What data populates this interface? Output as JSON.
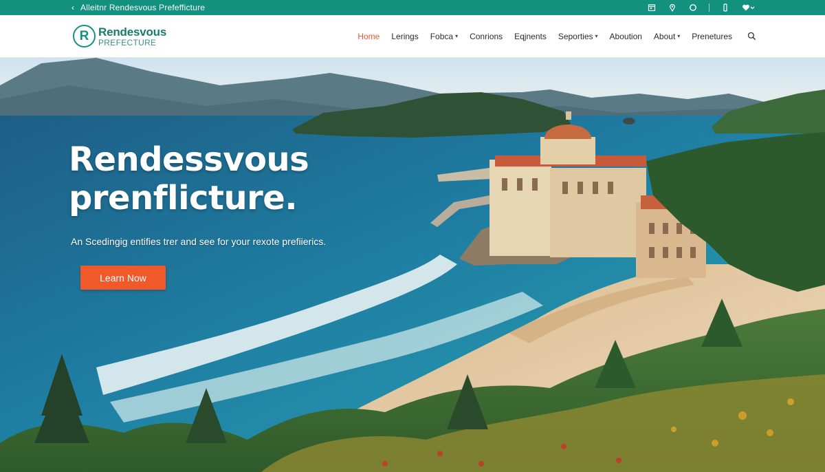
{
  "topbar": {
    "back_glyph": "‹",
    "title": "Alleitnr Rendesvous Prefefficture",
    "icons": [
      "calendar-icon",
      "location-pin-icon",
      "circle-icon",
      "phone-icon",
      "heart-dropdown-icon"
    ]
  },
  "header": {
    "logo_mark": "R",
    "logo_name": "Rendesvous",
    "logo_sub": "PREFECTURE",
    "nav": [
      {
        "label": "Home",
        "active": true,
        "dropdown": false
      },
      {
        "label": "Lerings",
        "active": false,
        "dropdown": false
      },
      {
        "label": "Fobca",
        "active": false,
        "dropdown": true
      },
      {
        "label": "Conrions",
        "active": false,
        "dropdown": false
      },
      {
        "label": "Eqjnents",
        "active": false,
        "dropdown": false
      },
      {
        "label": "Seporties",
        "active": false,
        "dropdown": true
      },
      {
        "label": "Aboution",
        "active": false,
        "dropdown": false
      },
      {
        "label": "About",
        "active": false,
        "dropdown": true
      },
      {
        "label": "Prenetures",
        "active": false,
        "dropdown": false
      }
    ],
    "caret": "▾",
    "search_icon": "search-icon"
  },
  "hero": {
    "title_line1": "Rendessvous",
    "title_line2": "prenflicture.",
    "subtitle": "An Scedingig entifies trer and see for your rexote prefiierics.",
    "cta_label": "Learn Now"
  },
  "colors": {
    "brand_teal": "#13917f",
    "accent_orange": "#f05a2a",
    "active_nav": "#e4572e"
  }
}
